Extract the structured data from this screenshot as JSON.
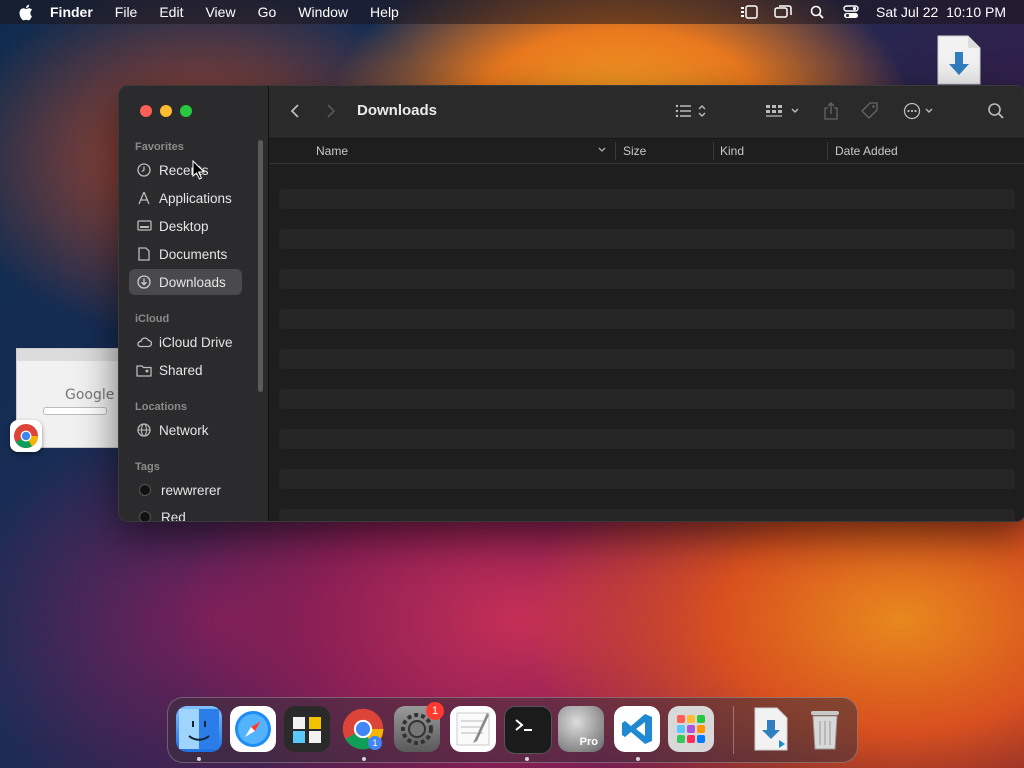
{
  "menubar": {
    "app_name": "Finder",
    "menus": [
      "File",
      "Edit",
      "View",
      "Go",
      "Window",
      "Help"
    ],
    "datetime": "Sat Jul 22  10:10 PM",
    "status_icons": [
      "stage-manager-icon",
      "screen-mirroring-icon",
      "spotlight-search-icon",
      "control-center-icon"
    ]
  },
  "finder": {
    "title": "Downloads",
    "sidebar": {
      "favorites_header": "Favorites",
      "favorites": [
        {
          "label": "Recents",
          "icon": "clock-icon"
        },
        {
          "label": "Applications",
          "icon": "applications-icon"
        },
        {
          "label": "Desktop",
          "icon": "desktop-icon"
        },
        {
          "label": "Documents",
          "icon": "document-icon"
        },
        {
          "label": "Downloads",
          "icon": "downloads-icon",
          "selected": true
        }
      ],
      "icloud_header": "iCloud",
      "icloud": [
        {
          "label": "iCloud Drive",
          "icon": "cloud-icon"
        },
        {
          "label": "Shared",
          "icon": "shared-folder-icon"
        }
      ],
      "locations_header": "Locations",
      "locations": [
        {
          "label": "Network",
          "icon": "globe-icon"
        }
      ],
      "tags_header": "Tags",
      "tags": [
        {
          "label": "rewwrerer",
          "color": "#111111"
        },
        {
          "label": "Red",
          "color": "#111111"
        }
      ]
    },
    "columns": {
      "name": "Name",
      "size": "Size",
      "kind": "Kind",
      "date_added": "Date Added"
    },
    "row_count": 9
  },
  "desktop": {
    "thumbnail_text": "Google"
  },
  "dock": {
    "apps": [
      "finder",
      "safari",
      "photo-booth",
      "chrome",
      "system-settings",
      "textedit",
      "terminal",
      "pro-app",
      "vscode",
      "launchpad",
      "downloads-stack",
      "trash"
    ],
    "system_settings_badge": "1",
    "chrome_badge": "1",
    "pro_label": "Pro"
  },
  "colors": {
    "accent_red": "#fe5f57",
    "accent_yellow": "#febc2e",
    "accent_green": "#28c840",
    "window_bg": "#1e1e1e",
    "sidebar_bg": "#2b2b2d"
  }
}
